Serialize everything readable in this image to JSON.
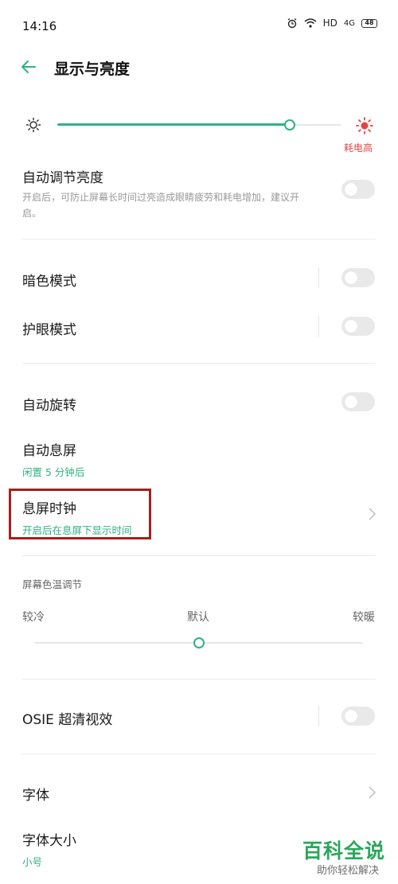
{
  "status_bar": {
    "time": "14:16",
    "signal_label": "HD",
    "network_label": "4G",
    "battery": "48"
  },
  "header": {
    "title": "显示与亮度"
  },
  "brightness": {
    "level": 0.82,
    "high_power_label": "耗电高"
  },
  "auto_brightness": {
    "title": "自动调节亮度",
    "desc_line1": "开启后，可防止屏幕长时间过亮造成眼睛疲劳和耗电增加，建议开",
    "desc_line2": "启。",
    "on": false
  },
  "dark_mode": {
    "title": "暗色模式",
    "on": false
  },
  "eye_comfort": {
    "title": "护眼模式",
    "on": false
  },
  "auto_rotate": {
    "title": "自动旋转",
    "on": false
  },
  "screen_timeout": {
    "title": "自动息屏",
    "value": "闲置 5 分钟后"
  },
  "aod_clock": {
    "title": "息屏时钟",
    "subtitle": "开启后在息屏下显示时间"
  },
  "color_temp": {
    "section_label": "屏幕色温调节",
    "cool_label": "较冷",
    "default_label": "默认",
    "warm_label": "较暖",
    "level": 0.5
  },
  "osie": {
    "title": "OSIE 超清视效",
    "on": false
  },
  "font": {
    "title": "字体"
  },
  "font_size": {
    "title": "字体大小",
    "value": "小号"
  },
  "watermark": {
    "title": "百科全说",
    "subtitle": "助你轻松解决"
  },
  "colors": {
    "accent": "#2fb281",
    "warning": "#e04545",
    "highlight_box": "#a51f1f"
  }
}
